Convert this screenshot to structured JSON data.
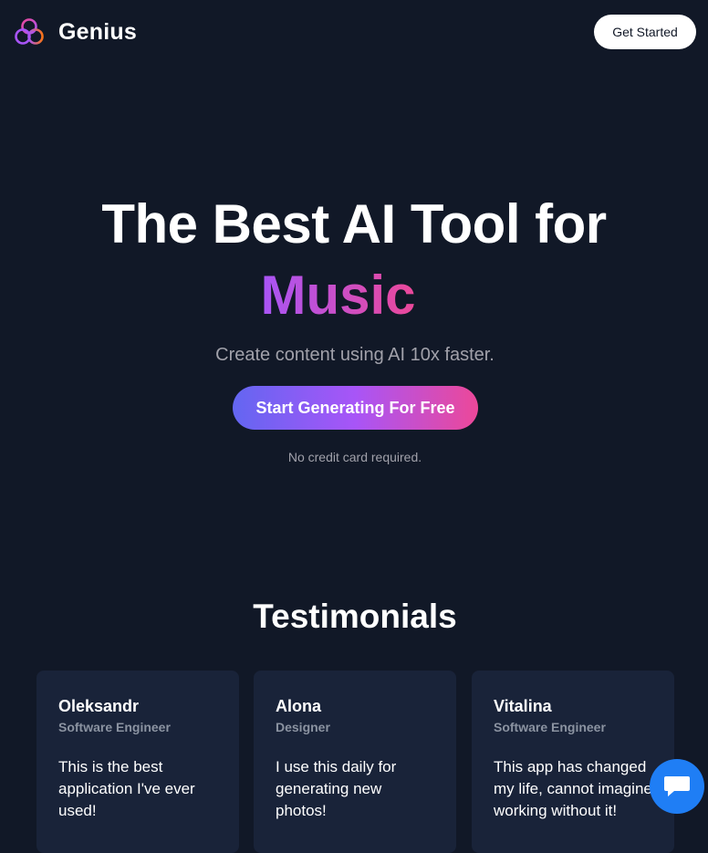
{
  "header": {
    "brand": "Genius",
    "get_started_label": "Get Started"
  },
  "hero": {
    "title_line1": "The Best AI Tool for",
    "title_highlight": "Music",
    "subtitle": "Create content using AI 10x faster.",
    "cta_label": "Start Generating For Free",
    "note": "No credit card required."
  },
  "testimonials": {
    "title": "Testimonials",
    "items": [
      {
        "name": "Oleksandr",
        "role": "Software Engineer",
        "quote_lines": [
          "This is the best",
          "application I've ever",
          "used!"
        ]
      },
      {
        "name": "Alona",
        "role": "Designer",
        "quote_lines": [
          "I use this daily for",
          "generating new",
          "photos!"
        ]
      },
      {
        "name": "Vitalina",
        "role": "Software Engineer",
        "quote_lines": [
          "This app has changed",
          "my life, cannot imagine",
          "working without it!"
        ]
      }
    ]
  },
  "icons": {
    "logo": "interlocking-rings-logo-icon",
    "chat": "chat-bubble-icon"
  },
  "colors": {
    "background": "#111827",
    "card_background": "#192339",
    "gradient_start": "#6366f1",
    "gradient_mid": "#a855f7",
    "gradient_end": "#ec4899",
    "chat_button": "#1f7ef5"
  }
}
